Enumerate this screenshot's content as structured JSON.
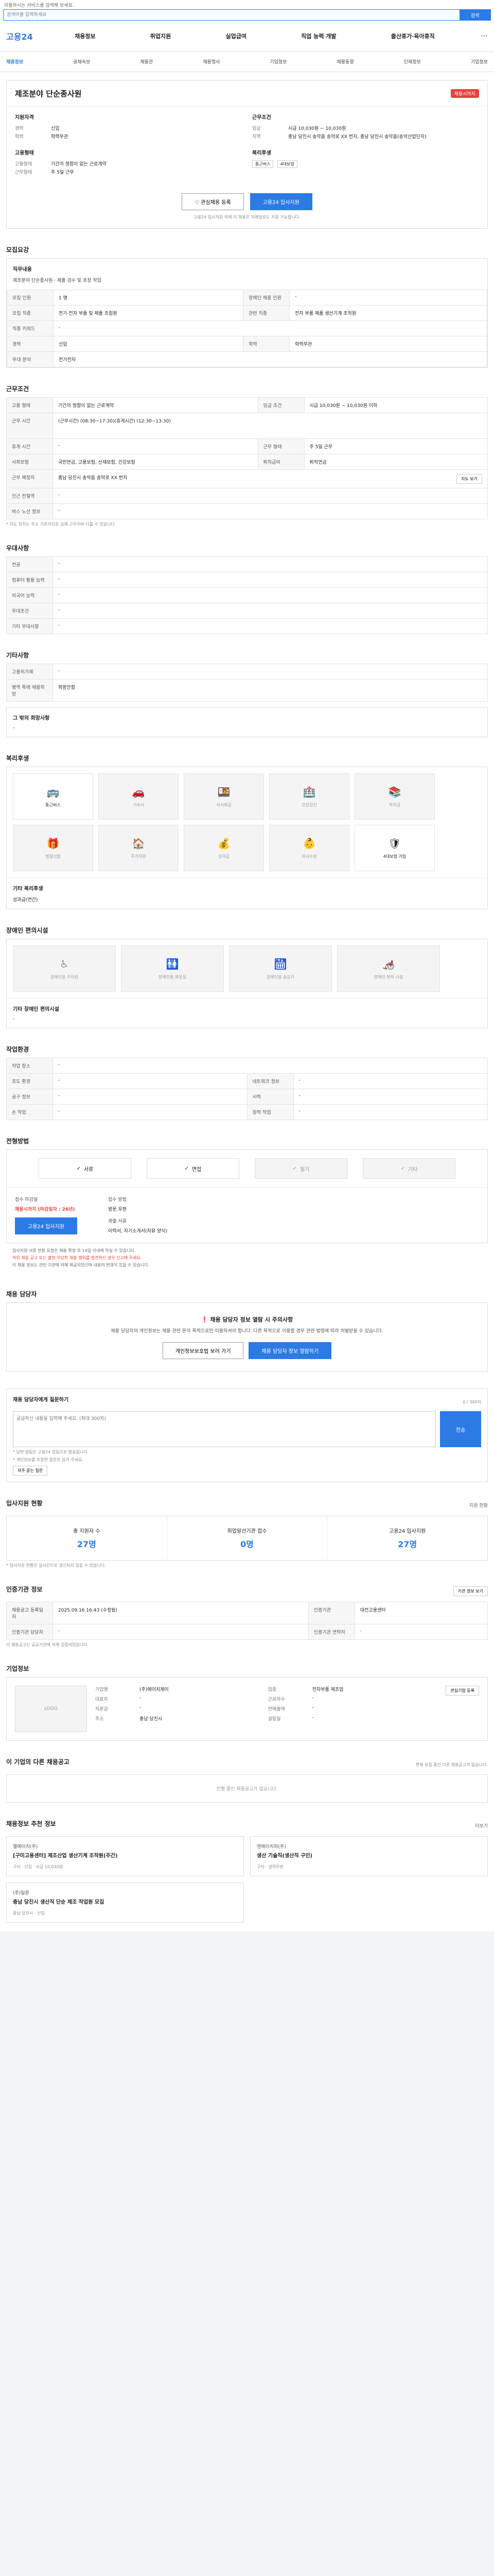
{
  "topnote": "이용하시는 서비스를 검색해 보세요.",
  "search": {
    "placeholder": "검색어를 입력하세요",
    "button": "검색"
  },
  "logo": "고용24",
  "gnb": [
    "채용정보",
    "취업지원",
    "실업급여",
    "직업 능력 개발",
    "출산휴가·육아휴직"
  ],
  "gnb_more": "⋯",
  "subnav": [
    {
      "label": "채용정보",
      "on": true
    },
    {
      "label": "공채속보"
    },
    {
      "label": "채용관",
      "on": false
    },
    {
      "label": "채용행사"
    },
    {
      "label": "기업정보"
    },
    {
      "label": "채용동향"
    },
    {
      "label": "인재정보"
    },
    {
      "label": "기업정보"
    }
  ],
  "job": {
    "title": "제조분야 단순종사원",
    "dday": "채용시까지",
    "qual_h": "지원자격",
    "qual": [
      {
        "k": "경력",
        "v": "신입"
      },
      {
        "k": "학력",
        "v": "학력무관"
      }
    ],
    "cond_h": "근무조건",
    "cond": [
      {
        "k": "임금",
        "v": "시급 10,030원 ~ 10,030원"
      },
      {
        "k": "지역",
        "v": "충남 당진시 송악읍 송악로 XX 번지, 충남 당진시 송악읍(송악산업단지)"
      }
    ],
    "type_h": "고용형태",
    "type": [
      {
        "k": "고용형태",
        "v": "기간의 정함이 없는 근로계약"
      },
      {
        "k": "근무형태",
        "v": "주 5일 근무"
      }
    ],
    "welfare_h": "복리후생",
    "welfare_tags": [
      "통근버스",
      "4대보험"
    ],
    "btn_scrap": "관심채용 등록",
    "btn_apply": "고용24 입사지원",
    "note": "고용24 입사지원 외에 이 채용은 이메일로도 지원 가능합니다."
  },
  "detail": {
    "h": "모집요강",
    "duty_h": "직무내용",
    "duty": "제조분야 단순종사원 · 제품 검수 및 포장 작업",
    "rows": [
      {
        "k": "모집 인원",
        "v": "1 명",
        "k2": "장애인 채용 인원",
        "v2": "-"
      },
      {
        "k": "모집 직종",
        "v": "전기·전자 부품 및 제품 조립원",
        "k2": "관련 직종",
        "v2": "전자 부품 제품 생산기계 조작원"
      },
      {
        "k": "직종 키워드",
        "v": "-",
        "k2": "",
        "v2": ""
      },
      {
        "k": "경력",
        "v": "신입",
        "k2": "학력",
        "v2": "학력무관"
      },
      {
        "k": "우대 분야",
        "v": "전기전자",
        "k2": "",
        "v2": ""
      }
    ]
  },
  "work": {
    "h": "근무조건",
    "rows": [
      {
        "k": "고용 형태",
        "v": "기간의 정함이 없는 근로계약",
        "k2": "임금 조건",
        "v2": "시급 10,030원 ~ 10,030원 이하"
      },
      {
        "k": "근무 시간",
        "v": "(근무시간) (08:30~17:30)(휴게시간) (12:30~13:30)",
        "k2": "",
        "v2": ""
      },
      {
        "k": "휴게 시간",
        "v": "-",
        "k2": "근무 형태",
        "v2": "주 5일 근무"
      },
      {
        "k": "사회보험",
        "v": "국민연금, 고용보험, 산재보험, 건강보험",
        "k2": "퇴직급여",
        "v2": "퇴직연금"
      },
      {
        "k": "근무 예정지",
        "v": "충남 당진시 송악읍 송악로 XX 번지",
        "k2": "",
        "v2": ""
      },
      {
        "k": "인근 전철역",
        "v": "-",
        "k2": "",
        "v2": ""
      },
      {
        "k": "버스 노선 정보",
        "v": "-",
        "k2": "",
        "v2": ""
      }
    ],
    "mapbtn": "지도 보기",
    "note": "* 지도 위치는 주소 기준이므로 실제 근무지와 다를 수 있습니다."
  },
  "pref": {
    "h": "우대사항",
    "rows": [
      {
        "k": "전공",
        "v": "-"
      },
      {
        "k": "컴퓨터 활용 능력",
        "v": "-"
      },
      {
        "k": "외국어 능력",
        "v": "-"
      },
      {
        "k": "우대조건",
        "v": "-"
      },
      {
        "k": "기타 우대사항",
        "v": "-"
      }
    ]
  },
  "etc": {
    "h": "기타사항",
    "rows": [
      {
        "k": "고용허가제",
        "v": "-"
      },
      {
        "k": "병역 특례 채용희망",
        "v": "희망안함"
      }
    ],
    "more_k": "그 밖의 희망사항",
    "more_v": "-"
  },
  "welfare": {
    "h": "복리후생",
    "items": [
      {
        "icon": "🚌",
        "label": "통근버스",
        "on": true
      },
      {
        "icon": "🚗",
        "label": "기숙사",
        "on": false
      },
      {
        "icon": "🍱",
        "label": "식사제공",
        "on": false
      },
      {
        "icon": "🏥",
        "label": "건강검진",
        "on": false
      },
      {
        "icon": "📚",
        "label": "학자금",
        "on": false
      },
      {
        "icon": "🎁",
        "label": "명절선물",
        "on": false
      },
      {
        "icon": "🏠",
        "label": "주거지원",
        "on": false
      },
      {
        "icon": "💰",
        "label": "상여금",
        "on": false
      },
      {
        "icon": "👶",
        "label": "자녀수당",
        "on": false
      },
      {
        "icon": "🛡",
        "label": "4대보험 가입",
        "on": true
      }
    ],
    "extra_k": "기타 복리후생",
    "extra_v": "성과급(연간)"
  },
  "disab": {
    "h": "장애인 편의시설",
    "items": [
      {
        "icon": "♿",
        "label": "장애인용 주차장"
      },
      {
        "icon": "🚻",
        "label": "장애인용 화장실"
      },
      {
        "icon": "🛗",
        "label": "장애인용 승강기"
      },
      {
        "icon": "🦽",
        "label": "장애인 편의 시설"
      }
    ],
    "extra_k": "기타 장애인 편의시설",
    "extra_v": "-"
  },
  "env": {
    "h": "작업환경",
    "rows": [
      {
        "k": "작업 장소",
        "v": "-",
        "k2": "",
        "v2": ""
      },
      {
        "k": "조도 환경",
        "v": "-",
        "k2": "네트워크 정보",
        "v2": "-"
      },
      {
        "k": "공구 정보",
        "v": "-",
        "k2": "시력",
        "v2": "-"
      },
      {
        "k": "손 작업",
        "v": "-",
        "k2": "청력 작업",
        "v2": "-"
      }
    ]
  },
  "prep": {
    "h": "전형방법",
    "items": [
      {
        "label": "서류",
        "on": true
      },
      {
        "label": "면접",
        "on": true
      },
      {
        "label": "필기",
        "on": false
      },
      {
        "label": "기타",
        "on": false
      }
    ]
  },
  "apply": {
    "deadline_k": "접수 마감일",
    "deadline_v": "채용시까지 (마감일자 : 26년)",
    "method_k": "접수 방법",
    "method_v": "방문,우편",
    "docs_k": "제출 서류",
    "docs_v": "이력서, 자기소개서(자유 양식)",
    "btn": "고용24 입사지원"
  },
  "bullets": [
    "입사지원 서류 반환 요청은 채용 확정 후 14일 이내에 하실 수 있습니다.",
    "허위 채용 공고 또는 불법·부당한 채용 행위를 발견하신 경우 신고해 주세요.",
    "이 채용 정보는 관련 기관에 의해 제공되었으며 내용의 변경이 있을 수 있습니다."
  ],
  "hr": {
    "h": "채용 담당자",
    "warn": "채용 담당자 정보 열람 시 주의사항",
    "p": "채용 담당자의 개인정보는 채용 관련 문의 목적으로만 이용하셔야 합니다. 다른 목적으로 이용할 경우 관련 법령에 따라 처벌받을 수 있습니다.",
    "btn1": "개인정보보호법 보러 가기",
    "btn2": "채용 담당자 정보 열람하기"
  },
  "qa": {
    "h": "채용 담당자에게 질문하기",
    "placeholder": "궁금하신 내용을 입력해 주세요. (최대 300자)",
    "count": "0 / 300자",
    "btn": "전송",
    "notes": [
      "* 답변 알림은 고용24 알림으로 발송됩니다.",
      "* 개인정보를 포함한 질문은 삼가 주세요."
    ],
    "more": "자주 묻는 질문"
  },
  "stats": {
    "h": "입사지원 현황",
    "more": "지원 현황",
    "items": [
      {
        "label": "총 지원자 수",
        "n": "27명"
      },
      {
        "label": "취업알선기관 접수",
        "n": "0명"
      },
      {
        "label": "고용24 입사지원",
        "n": "27명"
      }
    ],
    "note": "* 입사지원 현황은 실시간으로 갱신되지 않을 수 있습니다."
  },
  "reg": {
    "h": "인증기관 정보",
    "btn": "기관 정보 보기",
    "rows": [
      {
        "k": "채용공고 등록일자",
        "v": "2025.09.16 16:43 (수정됨)",
        "k2": "인증기관",
        "v2": "대전고용센터"
      },
      {
        "k": "인증기관 담당자",
        "v": "-",
        "k2": "인증기관 연락처",
        "v2": "-"
      }
    ],
    "note": "이 채용공고는 공공기관에 의해 검증되었습니다."
  },
  "company": {
    "h": "기업정보",
    "logo": "LOGO",
    "follow": "관심기업 등록",
    "rows": [
      {
        "k": "기업명",
        "v": "(주)에이치제이",
        "k2": "업종",
        "v2": "전자부품 제조업"
      },
      {
        "k": "대표자",
        "v": "-",
        "k2": "근로자수",
        "v2": "-"
      },
      {
        "k": "자본금",
        "v": "-",
        "k2": "연매출액",
        "v2": "-"
      },
      {
        "k": "주소",
        "v": "충남 당진시",
        "k2": "설립일",
        "v2": "-"
      }
    ]
  },
  "others": {
    "h": "이 기업의 다른 채용공고",
    "note": "현재 모집 중인 다른 채용공고가 없습니다.",
    "empty": "진행 중인 채용공고가 없습니다."
  },
  "recs": {
    "h": "채용정보 추천 정보",
    "more": "더보기",
    "items": [
      {
        "co": "엘에이치(주)",
        "t": "[구미고용센터] 제조산업 생산기계 조작원(주간)",
        "m": "구미 · 신입 · 시급 10,030원"
      },
      {
        "co": "엔에이치피(주)",
        "t": "생산 기술직(생산직 구인)",
        "m": "구미 · 경력무관"
      },
      {
        "co": "(주)일론",
        "t": "충남 당진시 생산직 단순 제조 작업원 모집",
        "m": "충남 당진시 · 신입"
      }
    ]
  }
}
